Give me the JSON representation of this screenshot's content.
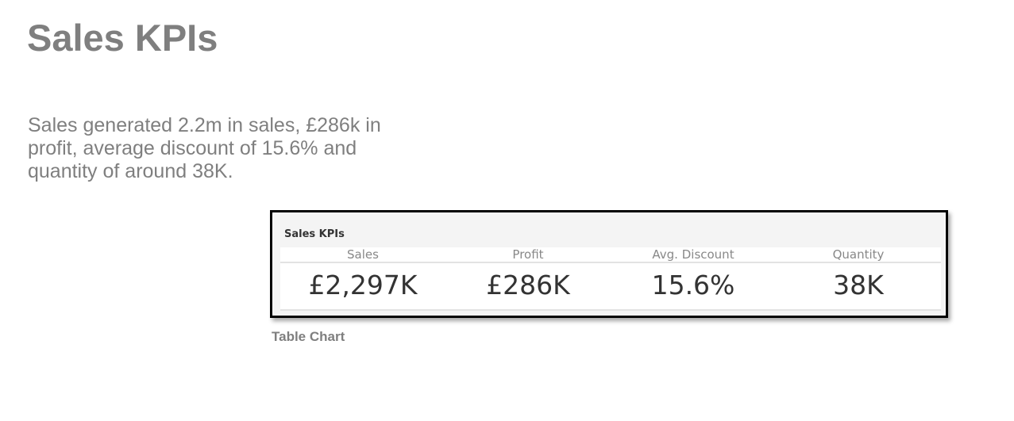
{
  "page": {
    "title": "Sales KPIs",
    "summary": "Sales generated 2.2m in sales, £286k in profit, average discount of 15.6% and quantity of around 38K.",
    "text_color": "#7f7f7f"
  },
  "figure": {
    "widget_title": "Sales KPIs",
    "caption": "Table Chart",
    "border_color": "#000000"
  },
  "chart_data": {
    "type": "table",
    "title": "Sales KPIs",
    "columns": [
      "Sales",
      "Profit",
      "Avg. Discount",
      "Quantity"
    ],
    "rows": [
      [
        "£2,297K",
        "£286K",
        "15.6%",
        "38K"
      ]
    ]
  }
}
